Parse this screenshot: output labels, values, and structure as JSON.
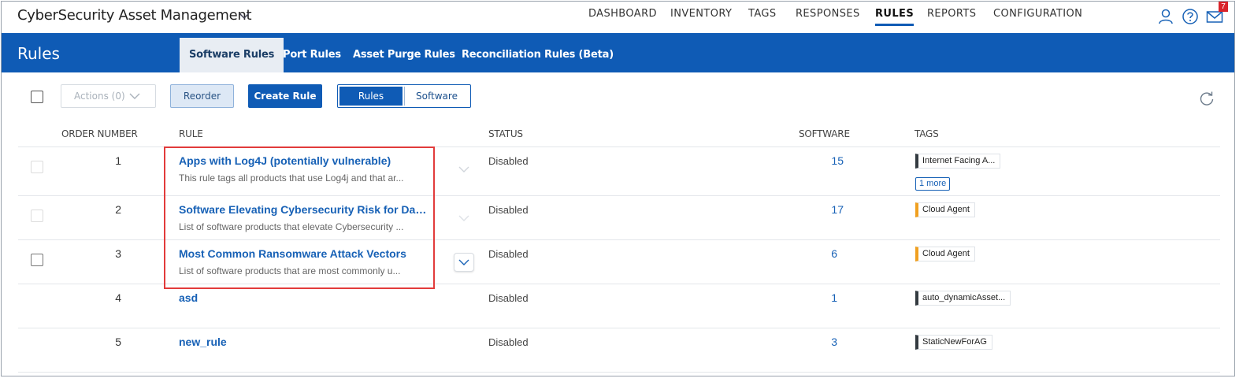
{
  "app": {
    "title": "CyberSecurity Asset Management"
  },
  "nav": [
    "DASHBOARD",
    "INVENTORY",
    "TAGS",
    "RESPONSES",
    "RULES",
    "REPORTS",
    "CONFIGURATION"
  ],
  "nav_active": "RULES",
  "header_icons": [
    "user-icon",
    "help-icon",
    "mail-icon"
  ],
  "mail_badge": "7",
  "section_title": "Rules",
  "subtabs": [
    "Software Rules",
    "Port Rules",
    "Asset Purge Rules",
    "Reconciliation Rules (Beta)"
  ],
  "subtab_active": "Software Rules",
  "toolbar": {
    "actions_label": "Actions (0)",
    "reorder_label": "Reorder",
    "create_label": "Create Rule",
    "view_rules_label": "Rules",
    "view_software_label": "Software"
  },
  "columns": {
    "order": "ORDER NUMBER",
    "rule": "RULE",
    "status": "STATUS",
    "software": "SOFTWARE",
    "tags": "TAGS"
  },
  "rows": [
    {
      "order": "1",
      "name": "Apps with Log4J (potentially vulnerable)",
      "description": "This rule tags all products that use Log4j and that ar...",
      "status": "Disabled",
      "software": "15",
      "tag": "Internet Facing A...",
      "tag_color": "#333a40",
      "more": "1 more"
    },
    {
      "order": "2",
      "name": "Software Elevating Cybersecurity Risk for Dat...",
      "description": "List of software products that elevate Cybersecurity ...",
      "status": "Disabled",
      "software": "17",
      "tag": "Cloud Agent",
      "tag_color": "#f0a020"
    },
    {
      "order": "3",
      "name": "Most Common Ransomware Attack Vectors",
      "description": "List of software products that are most commonly u...",
      "status": "Disabled",
      "software": "6",
      "tag": "Cloud Agent",
      "tag_color": "#f0a020"
    },
    {
      "order": "4",
      "name": "asd",
      "description": "",
      "status": "Disabled",
      "software": "1",
      "tag": "auto_dynamicAsset...",
      "tag_color": "#333a40"
    },
    {
      "order": "5",
      "name": "new_rule",
      "description": "",
      "status": "Disabled",
      "software": "3",
      "tag": "StaticNewForAG",
      "tag_color": "#333a40"
    }
  ],
  "colors": {
    "brand_blue": "#0f5bb5",
    "link_blue": "#1761b6",
    "highlight_red": "#e23b3b"
  }
}
